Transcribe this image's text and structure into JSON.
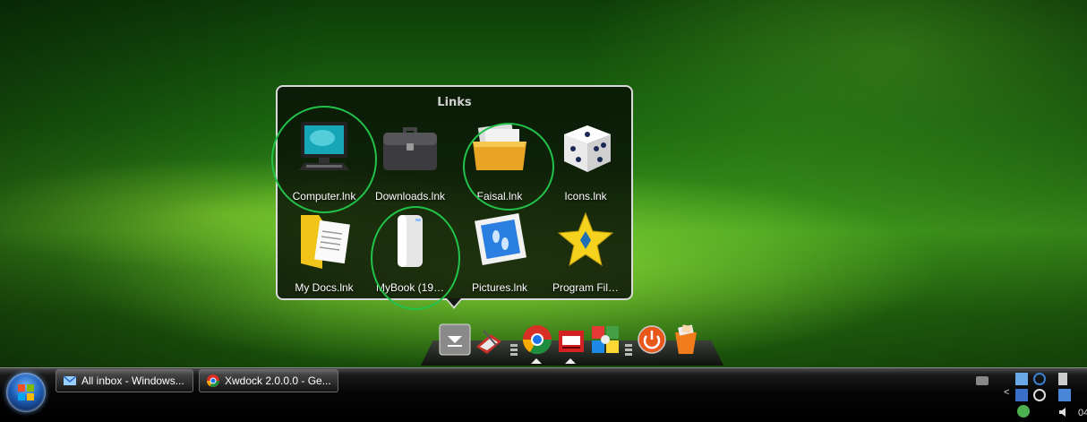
{
  "popup": {
    "title": "Links",
    "items": [
      {
        "label": "Computer.lnk",
        "icon": "computer-icon",
        "highlighted": true
      },
      {
        "label": "Downloads.lnk",
        "icon": "briefcase-icon",
        "highlighted": false
      },
      {
        "label": "Faisal.lnk",
        "icon": "folder-icon",
        "highlighted": true
      },
      {
        "label": "Icons.lnk",
        "icon": "dice-icon",
        "highlighted": false
      },
      {
        "label": "My Docs.lnk",
        "icon": "documents-folder-icon",
        "highlighted": false
      },
      {
        "label": "MyBook (19…",
        "icon": "external-drive-icon",
        "highlighted": true
      },
      {
        "label": "Pictures.lnk",
        "icon": "pictures-icon",
        "highlighted": false
      },
      {
        "label": "Program Fil…",
        "icon": "star-icon",
        "highlighted": false
      }
    ]
  },
  "dock": {
    "items": [
      "stack-down-icon",
      "editor-icon",
      "chrome-icon",
      "mailbox-icon",
      "puzzle-icon",
      "power-icon",
      "recycle-bin-icon"
    ]
  },
  "taskbar": {
    "buttons": [
      {
        "label": "All inbox - Windows...",
        "icon": "mail-app-icon"
      },
      {
        "label": "Xwdock 2.0.0.0 - Ge...",
        "icon": "chrome-icon"
      }
    ],
    "tray": {
      "arrow": "<",
      "time_fragment": "04"
    }
  },
  "colors": {
    "highlight_ring": "#22c24a",
    "popup_border": "#d9d9d9"
  }
}
